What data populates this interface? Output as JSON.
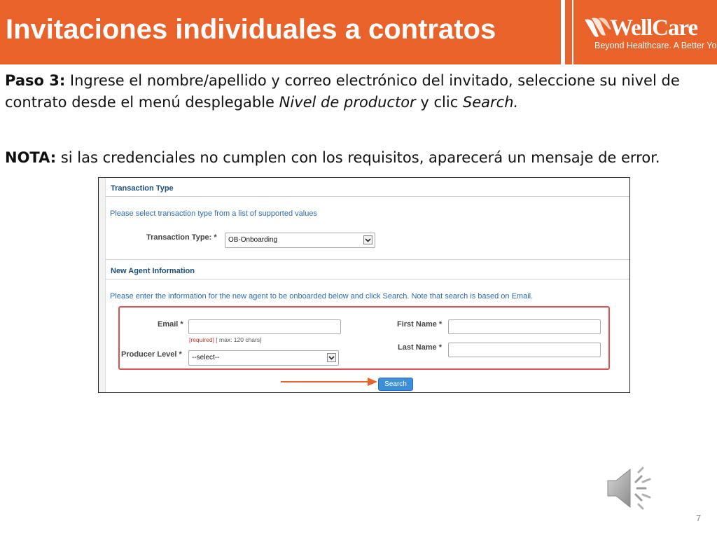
{
  "slide": {
    "title": "Invitaciones individuales a contratos",
    "page_number": "7",
    "accent_color": "#E8622A"
  },
  "logo": {
    "name": "WellCare",
    "tagline": "Beyond Healthcare. A Better You.",
    "icon": "wellcare-swoosh-icon"
  },
  "body": {
    "paso_label": "Paso 3:",
    "paso_text_1": " Ingrese el nombre/apellido y correo electrónico del invitado, seleccione su nivel de contrato desde el menú desplegable ",
    "paso_italic_1": "Nivel de productor",
    "paso_text_2": " y clic ",
    "paso_italic_2": "Search.",
    "nota_label": "NOTA:",
    "nota_text": " si las credenciales no cumplen con los requisitos, aparecerá un mensaje de error."
  },
  "form": {
    "transaction_section": {
      "title": "Transaction Type",
      "description": "Please select transaction type from a list of supported values",
      "field_label": "Transaction Type:",
      "required_mark": "*",
      "selected_value": "OB-Onboarding"
    },
    "agent_section": {
      "title": "New Agent Information",
      "description": "Please enter the information for the new agent to be onboarded below and click Search. Note that search is based on Email.",
      "email_label": "Email",
      "required_mark": "*",
      "email_value": "",
      "email_hint_required": "[required]",
      "email_hint_max": " [ max: 120 chars]",
      "first_name_label": "First Name",
      "first_name_value": "",
      "last_name_label": "Last Name",
      "last_name_value": "",
      "producer_level_label": "Producer Level",
      "producer_level_value": "--select--",
      "search_label": "Search"
    },
    "highlight_color": "#e05050",
    "arrow_color": "#E8622A"
  },
  "audio": {
    "icon": "speaker-icon"
  }
}
